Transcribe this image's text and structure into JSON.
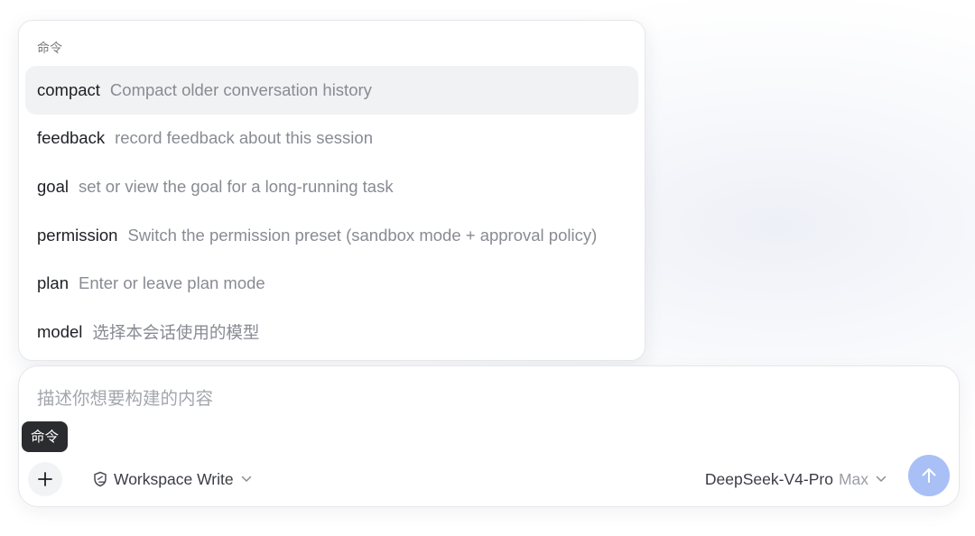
{
  "command_menu": {
    "header": "命令",
    "items": [
      {
        "name": "compact",
        "description": "Compact older conversation history"
      },
      {
        "name": "feedback",
        "description": "record feedback about this session"
      },
      {
        "name": "goal",
        "description": "set or view the goal for a long-running task"
      },
      {
        "name": "permission",
        "description": "Switch the permission preset (sandbox mode + approval policy)"
      },
      {
        "name": "plan",
        "description": "Enter or leave plan mode"
      },
      {
        "name": "model",
        "description": "选择本会话使用的模型"
      }
    ],
    "active_index": 0
  },
  "composer": {
    "placeholder": "描述你想要构建的内容",
    "value": "",
    "tooltip": "命令",
    "plus_icon": "plus-icon",
    "workspace": {
      "icon": "shield-edit-icon",
      "label": "Workspace Write"
    },
    "model": {
      "name": "DeepSeek-V4-Pro",
      "mode": "Max"
    },
    "send_icon": "arrow-up-icon"
  },
  "colors": {
    "accent_send_disabled": "#a8c0f6",
    "active_row": "#f1f2f4",
    "tooltip_bg": "#2b2c2f",
    "text_primary": "#1d1f24",
    "text_secondary": "#888b93"
  }
}
